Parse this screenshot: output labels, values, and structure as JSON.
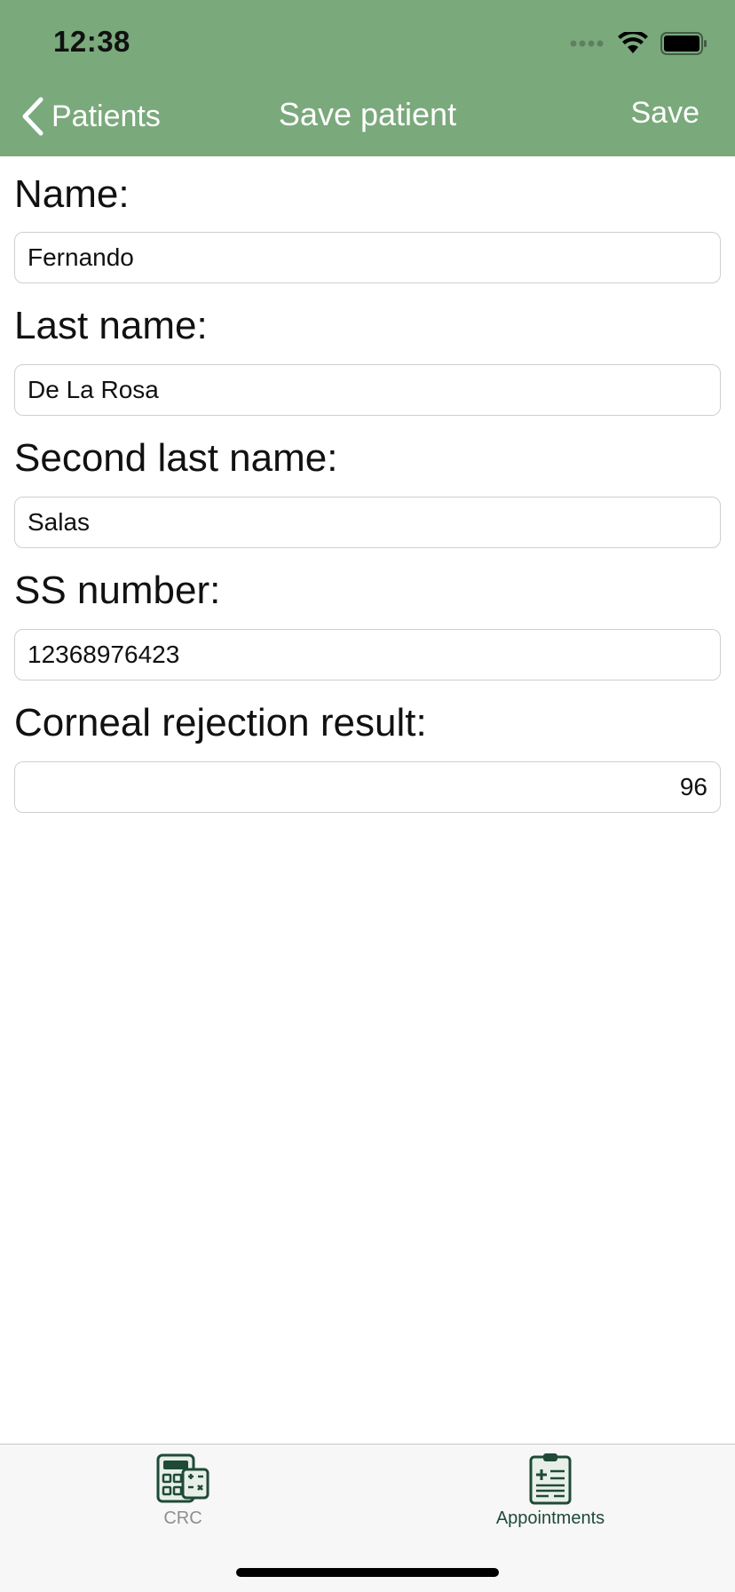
{
  "status_bar": {
    "time": "12:38"
  },
  "nav": {
    "back_label": "Patients",
    "title": "Save patient",
    "save_label": "Save"
  },
  "form": {
    "fields": [
      {
        "label": "Name:",
        "value": "Fernando"
      },
      {
        "label": "Last name:",
        "value": "De La Rosa"
      },
      {
        "label": "Second last name:",
        "value": "Salas"
      },
      {
        "label": "SS number:",
        "value": "12368976423"
      },
      {
        "label": "Corneal rejection result:",
        "value": "96"
      }
    ]
  },
  "tabbar": {
    "tabs": [
      {
        "label": "CRC",
        "icon": "calculator-icon",
        "active": false
      },
      {
        "label": "Appointments",
        "icon": "clipboard-icon",
        "active": true
      }
    ]
  },
  "colors": {
    "header": "#7aa97c",
    "tab_active": "#1f4a37",
    "tab_inactive": "#8e8e93"
  }
}
